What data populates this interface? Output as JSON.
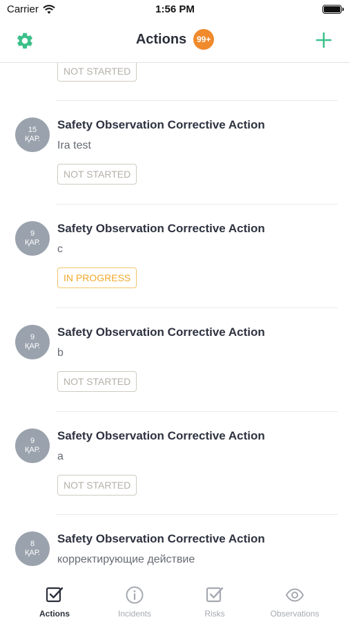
{
  "status_bar": {
    "carrier": "Carrier",
    "time": "1:56 PM"
  },
  "header": {
    "title": "Actions",
    "badge": "99+"
  },
  "list": {
    "partial_item": {
      "status": "NOT STARTED"
    },
    "items": [
      {
        "day": "15",
        "month": "ҚАР.",
        "title": "Safety Observation  Corrective Action",
        "subtitle": "Ira test",
        "status": "NOT STARTED"
      },
      {
        "day": "9",
        "month": "ҚАР.",
        "title": "Safety Observation  Corrective Action",
        "subtitle": "c",
        "status": "IN PROGRESS"
      },
      {
        "day": "9",
        "month": "ҚАР.",
        "title": "Safety Observation  Corrective Action",
        "subtitle": "b",
        "status": "NOT STARTED"
      },
      {
        "day": "9",
        "month": "ҚАР.",
        "title": "Safety Observation  Corrective Action",
        "subtitle": "a",
        "status": "NOT STARTED"
      },
      {
        "day": "8",
        "month": "ҚАР.",
        "title": "Safety Observation  Corrective Action",
        "subtitle": "корректирующие действие"
      }
    ]
  },
  "tabbar": {
    "tabs": [
      {
        "label": "Actions",
        "icon": "checkbox-icon",
        "active": true
      },
      {
        "label": "Incidents",
        "icon": "info-icon",
        "active": false
      },
      {
        "label": "Risks",
        "icon": "checkbox-icon",
        "active": false
      },
      {
        "label": "Observations",
        "icon": "eye-icon",
        "active": false
      }
    ]
  },
  "colors": {
    "accent": "#3cc08a",
    "badge": "#f08a2c",
    "in_progress": "#efa92b",
    "avatar": "#9aa3ad"
  }
}
